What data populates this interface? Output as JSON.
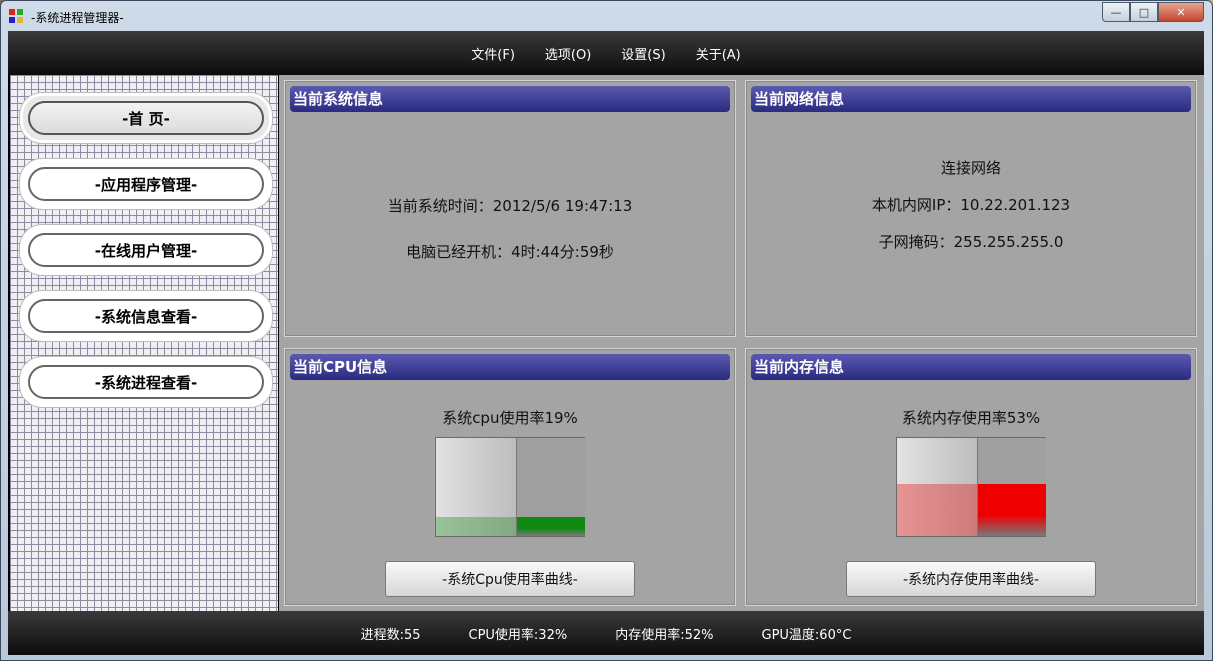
{
  "window": {
    "title": "-系统进程管理器-"
  },
  "controls": {
    "minimize": "—",
    "maximize": "□",
    "close": "✕"
  },
  "menu": [
    "文件(F)",
    "选项(O)",
    "设置(S)",
    "关于(A)"
  ],
  "sidebar": {
    "items": [
      {
        "label": "-首  页-",
        "active": true
      },
      {
        "label": "-应用程序管理-",
        "active": false
      },
      {
        "label": "-在线用户管理-",
        "active": false
      },
      {
        "label": "-系统信息查看-",
        "active": false
      },
      {
        "label": "-系统进程查看-",
        "active": false
      }
    ]
  },
  "system_panel": {
    "title": "当前系统信息",
    "time": "当前系统时间：2012/5/6 19:47:13",
    "uptime": "电脑已经开机：4时:44分:59秒"
  },
  "network_panel": {
    "title": "当前网络信息",
    "status": "连接网络",
    "ip": "本机内网IP：10.22.201.123",
    "mask": "子网掩码：255.255.255.0"
  },
  "cpu_panel": {
    "title": "当前CPU信息",
    "usage_text": "系统cpu使用率19%",
    "usage_level": 0.19,
    "button": "-系统Cpu使用率曲线-",
    "color": "#118811"
  },
  "memory_panel": {
    "title": "当前内存信息",
    "usage_text": "系统内存使用率53%",
    "usage_level": 0.53,
    "button": "-系统内存使用率曲线-",
    "color": "#ee0000"
  },
  "status": {
    "processes": "进程数:55",
    "cpu": "CPU使用率:32%",
    "memory": "内存使用率:52%",
    "gpu": "GPU温度:60°C"
  },
  "colors": {
    "panel_header": "#33338a",
    "background": "#a5a5a5"
  }
}
